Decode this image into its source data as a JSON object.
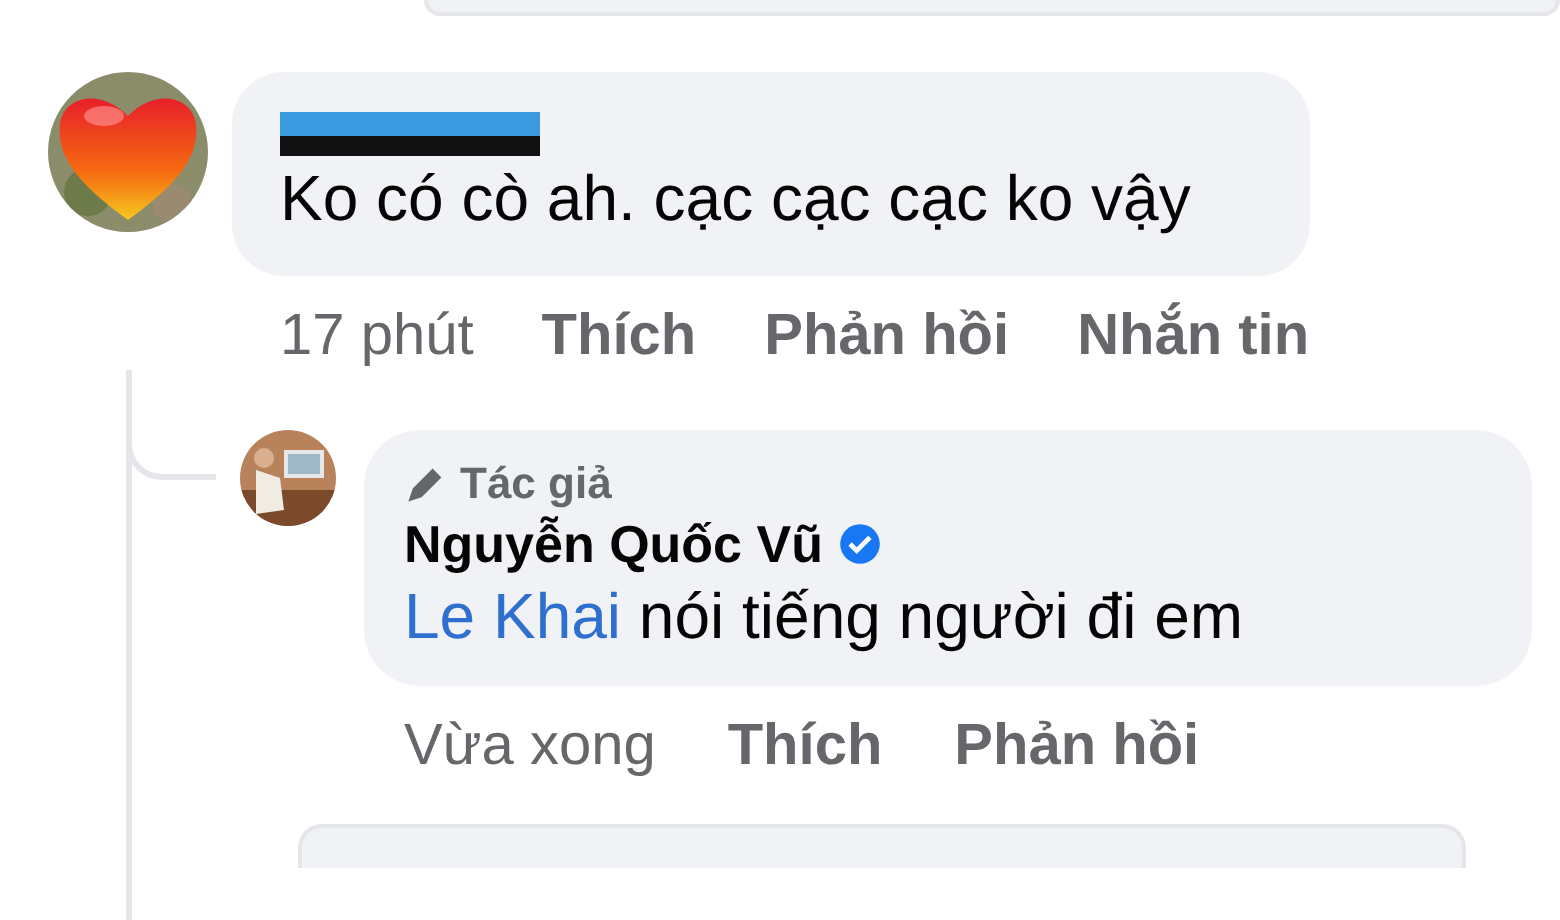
{
  "comments": [
    {
      "author_redacted": true,
      "text": "Ko có cò ah. cạc cạc cạc ko vậy",
      "actions": [
        {
          "label": "17 phút",
          "kind": "time"
        },
        {
          "label": "Thích",
          "kind": "action"
        },
        {
          "label": "Phản hồi",
          "kind": "action"
        },
        {
          "label": "Nhắn tin",
          "kind": "action"
        }
      ],
      "replies": [
        {
          "author": "Nguyễn Quốc Vũ",
          "badge": "Tác giả",
          "verified": true,
          "mention": "Le Khai",
          "text": " nói tiếng người đi em",
          "actions": [
            {
              "label": "Vừa xong",
              "kind": "time"
            },
            {
              "label": "Thích",
              "kind": "action"
            },
            {
              "label": "Phản hồi",
              "kind": "action"
            }
          ]
        }
      ]
    }
  ]
}
